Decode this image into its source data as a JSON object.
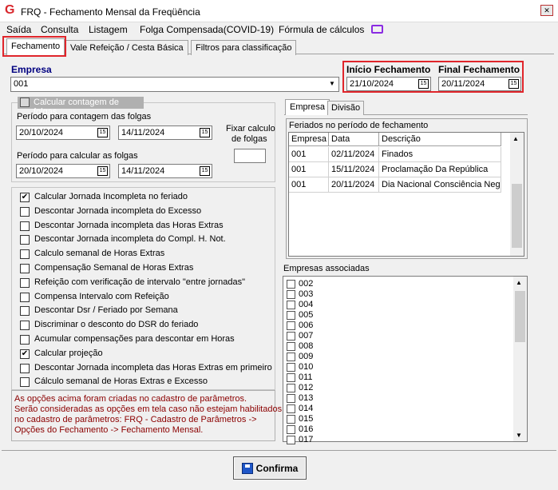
{
  "window": {
    "title": "FRQ - Fechamento Mensal da Freqüência",
    "logo": "G"
  },
  "menu": [
    "Saída",
    "Consulta",
    "Listagem",
    "Folga Compensada(COVID-19)",
    "Fórmula de cálculos"
  ],
  "tabs": [
    "Fechamento",
    "Vale Refeição / Cesta Básica",
    "Filtros para classificação"
  ],
  "empresa": {
    "label": "Empresa",
    "value": "001"
  },
  "inicio": {
    "label": "Início Fechamento",
    "value": "21/10/2024"
  },
  "final": {
    "label": "Final Fechamento",
    "value": "20/11/2024"
  },
  "folgas": {
    "group_label": "Calcular contagem de folgas",
    "contagem_label": "Período para contagem das folgas",
    "contagem_de": "20/10/2024",
    "contagem_ate": "14/11/2024",
    "calcular_label": "Período para calcular as folgas",
    "calcular_de": "20/10/2024",
    "calcular_ate": "14/11/2024",
    "fixar_label1": "Fixar calculo",
    "fixar_label2": "de folgas",
    "fixar_value": ""
  },
  "options": [
    {
      "label": "Calcular Jornada Incompleta no feriado",
      "checked": true
    },
    {
      "label": "Descontar Jornada incompleta do Excesso",
      "checked": false
    },
    {
      "label": "Descontar Jornada incompleta das Horas Extras",
      "checked": false
    },
    {
      "label": "Descontar Jornada incompleta do Compl. H. Not.",
      "checked": false
    },
    {
      "label": "Calculo semanal de Horas Extras",
      "checked": false
    },
    {
      "label": "Compensação Semanal de Horas Extras",
      "checked": false
    },
    {
      "label": "Refeição com verificação de intervalo \"entre jornadas\"",
      "checked": false
    },
    {
      "label": "Compensa Intervalo com Refeição",
      "checked": false
    },
    {
      "label": "Descontar Dsr / Feriado por Semana",
      "checked": false
    },
    {
      "label": "Discriminar o desconto do DSR do feriado",
      "checked": false
    },
    {
      "label": "Acumular compensações para descontar em Horas",
      "checked": false
    },
    {
      "label": "Calcular projeção",
      "checked": true
    },
    {
      "label": "Descontar Jornada incompleta das Horas Extras em primeiro",
      "checked": false
    },
    {
      "label": "Cálculo semanal de Horas Extras e Excesso",
      "checked": false
    }
  ],
  "note": {
    "line1": "As opções acima foram criadas no cadastro de parâmetros.",
    "line2": "Serão consideradas as opções em tela caso não estejam habilitados",
    "line3": "no cadastro de parâmetros: FRQ - Cadastro de Parâmetros ->",
    "line4": "Opções do Fechamento -> Fechamento Mensal."
  },
  "right_tabs": [
    "Empresa",
    "Divisão"
  ],
  "feriados": {
    "label": "Feriados no período de fechamento",
    "columns": [
      "Empresa",
      "Data",
      "Descrição"
    ],
    "rows": [
      [
        "001",
        "02/11/2024",
        "Finados"
      ],
      [
        "001",
        "15/11/2024",
        "Proclamação Da República"
      ],
      [
        "001",
        "20/11/2024",
        "Dia Nacional Consciência Negra"
      ]
    ]
  },
  "associadas": {
    "label": "Empresas associadas",
    "items": [
      "002",
      "003",
      "004",
      "005",
      "006",
      "007",
      "008",
      "009",
      "010",
      "011",
      "012",
      "013",
      "014",
      "015",
      "016",
      "017"
    ]
  },
  "confirm_label": "Confirma",
  "colors": {
    "highlight": "#e0252b",
    "label_blue": "#000080",
    "note_red": "#8b0000"
  }
}
